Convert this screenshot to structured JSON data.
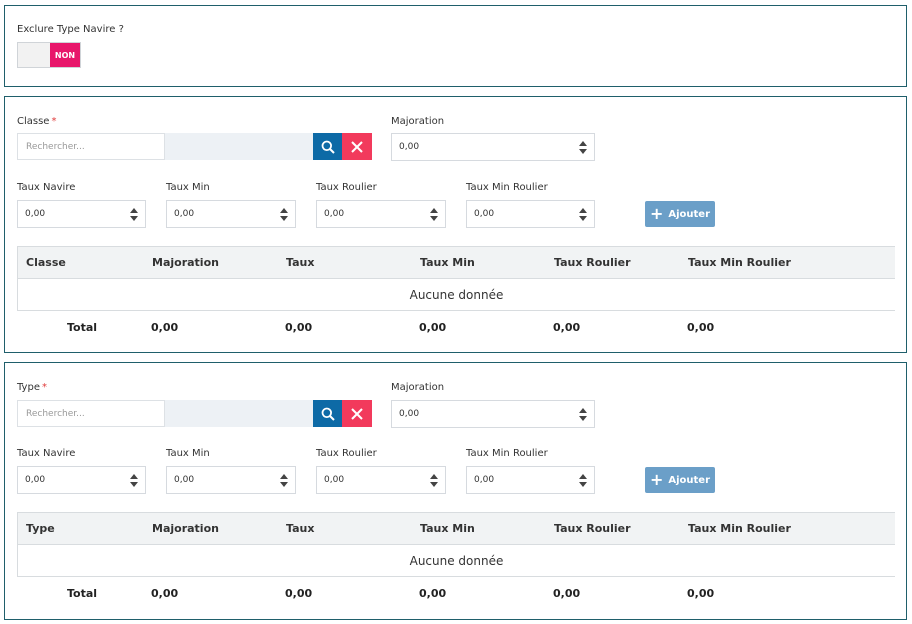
{
  "exclude": {
    "label": "Exclure Type Navire ?",
    "toggle_state": "NON"
  },
  "sections": [
    {
      "search_label": "Classe",
      "required_mark": "*",
      "search_placeholder": "Rechercher...",
      "majoration_label": "Majoration",
      "majoration_value": "0,00",
      "fields": [
        {
          "label": "Taux Navire",
          "value": "0,00"
        },
        {
          "label": "Taux Min",
          "value": "0,00"
        },
        {
          "label": "Taux Roulier",
          "value": "0,00"
        },
        {
          "label": "Taux Min Roulier",
          "value": "0,00"
        }
      ],
      "add_label": "Ajouter",
      "table": {
        "columns": [
          "Classe",
          "Majoration",
          "Taux",
          "Taux Min",
          "Taux Roulier",
          "Taux Min Roulier"
        ],
        "empty_text": "Aucune donnée",
        "totals": [
          "Total",
          "0,00",
          "0,00",
          "0,00",
          "0,00",
          "0,00"
        ]
      }
    },
    {
      "search_label": "Type",
      "required_mark": "*",
      "search_placeholder": "Rechercher...",
      "majoration_label": "Majoration",
      "majoration_value": "0,00",
      "fields": [
        {
          "label": "Taux Navire",
          "value": "0,00"
        },
        {
          "label": "Taux Min",
          "value": "0,00"
        },
        {
          "label": "Taux Roulier",
          "value": "0,00"
        },
        {
          "label": "Taux Min Roulier",
          "value": "0,00"
        }
      ],
      "add_label": "Ajouter",
      "table": {
        "columns": [
          "Type",
          "Majoration",
          "Taux",
          "Taux Min",
          "Taux Roulier",
          "Taux Min Roulier"
        ],
        "empty_text": "Aucune donnée",
        "totals": [
          "Total",
          "0,00",
          "0,00",
          "0,00",
          "0,00",
          "0,00"
        ]
      }
    }
  ],
  "colors": {
    "accent_pink": "#e8176b",
    "search_blue": "#0d6aa6",
    "clear_red": "#f23a5c",
    "add_button": "#6b9fc8",
    "panel_border": "#1f5f6b"
  },
  "icons": [
    "search-icon",
    "close-icon",
    "plus-icon",
    "spinner-up-icon",
    "spinner-down-icon"
  ]
}
